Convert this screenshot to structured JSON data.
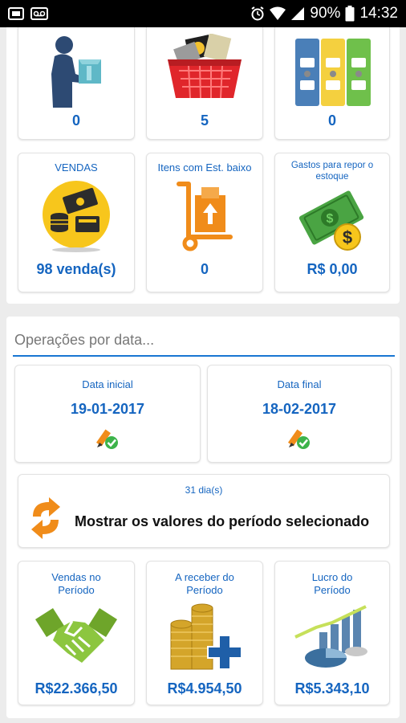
{
  "status_bar": {
    "battery": "90%",
    "time": "14:32",
    "icons": [
      "image-notification-icon",
      "voicemail-icon",
      "alarm-icon",
      "wifi-icon",
      "signal-icon",
      "battery-icon"
    ]
  },
  "summary_cards": [
    {
      "title": "",
      "value": "0",
      "icon": "delivery-person-icon"
    },
    {
      "title": "",
      "value": "5",
      "icon": "shopping-basket-icon"
    },
    {
      "title": "",
      "value": "0",
      "icon": "binders-icon"
    },
    {
      "title": "VENDAS",
      "value": "98 venda(s)",
      "icon": "money-coins-icon"
    },
    {
      "title": "Itens com Est. baixo",
      "value": "0",
      "icon": "hand-truck-icon"
    },
    {
      "title": "Gastos para repor o estoque",
      "value": "R$ 0,00",
      "icon": "dollar-bill-icon"
    }
  ],
  "search": {
    "placeholder": "Operações por data..."
  },
  "date_start": {
    "label": "Data inicial",
    "value": "19-01-2017",
    "icon": "edit-pencil-check-icon"
  },
  "date_end": {
    "label": "Data final",
    "value": "18-02-2017",
    "icon": "edit-pencil-check-icon"
  },
  "period_button": {
    "days": "31 dia(s)",
    "label": "Mostrar os valores do período selecionado",
    "icon": "refresh-arrows-icon"
  },
  "period_cards": [
    {
      "title": "Vendas no Período",
      "value": "R$22.366,50",
      "icon": "handshake-icon"
    },
    {
      "title": "A receber do Período",
      "value": "R$4.954,50",
      "icon": "coins-plus-icon"
    },
    {
      "title": "Lucro do Período",
      "value": "R$5.343,10",
      "icon": "growth-chart-icon"
    }
  ],
  "colors": {
    "accent": "#1565c0",
    "underline": "#1976d2",
    "background": "#ececec",
    "statusbar": "#000000"
  }
}
